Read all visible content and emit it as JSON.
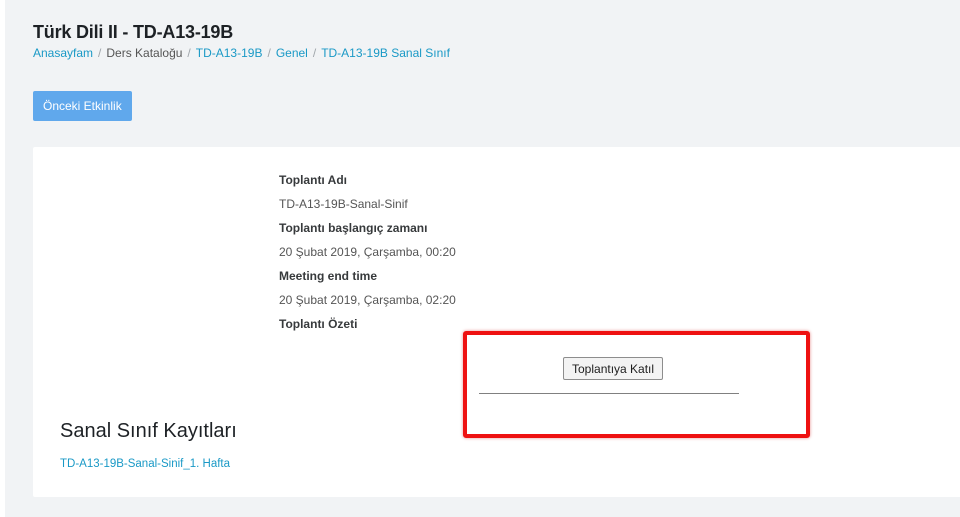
{
  "header": {
    "title": "Türk Dili II - TD-A13-19B",
    "breadcrumb": [
      {
        "label": "Anasayfam",
        "link": true
      },
      {
        "label": "Ders Kataloğu",
        "link": false
      },
      {
        "label": "TD-A13-19B",
        "link": true
      },
      {
        "label": "Genel",
        "link": true
      },
      {
        "label": "TD-A13-19B Sanal Sınıf",
        "link": true
      }
    ],
    "separator": "/"
  },
  "nav": {
    "previous_activity_label": "Önceki Etkinlik"
  },
  "meeting": {
    "name_label": "Toplantı Adı",
    "name_value": "TD-A13-19B-Sanal-Sinif",
    "start_label": "Toplantı başlangıç zamanı",
    "start_value": "20 Şubat 2019, Çarşamba, 00:20",
    "end_label": "Meeting end time",
    "end_value": "20 Şubat 2019, Çarşamba, 02:20",
    "summary_label": "Toplantı Özeti",
    "join_button_label": "Toplantıya Katıl"
  },
  "recordings": {
    "heading": "Sanal Sınıf Kayıtları",
    "items": [
      "TD-A13-19B-Sanal-Sinif_1. Hafta"
    ]
  },
  "colors": {
    "link": "#1a99c6",
    "primary_button": "#60a8ec",
    "highlight": "#ee1111",
    "page_background": "#f1f3f5"
  }
}
